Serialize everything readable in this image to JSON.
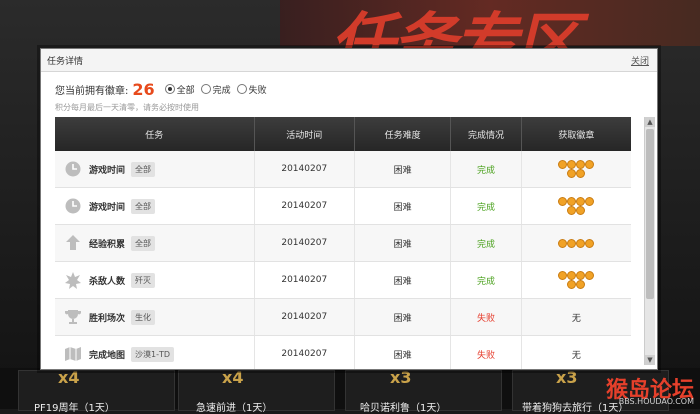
{
  "background": {
    "banner_text": "任务专区",
    "multipliers": [
      "x4",
      "x4",
      "x3",
      "x3"
    ],
    "strip_texts": [
      "PF19周年（1天）",
      "急速前进（1天）",
      "哈贝诺利鲁（1天）",
      "带着狗狗去旅行（1天）"
    ],
    "logo_text": "猴岛论坛",
    "logo_url": "BBS.HOUDAO.COM"
  },
  "modal": {
    "title": "任务详情",
    "close_label": "关闭",
    "summary_label": "您当前拥有徽章:",
    "badge_count": "26",
    "filters": [
      {
        "label": "全部",
        "selected": true
      },
      {
        "label": "完成",
        "selected": false
      },
      {
        "label": "失败",
        "selected": false
      }
    ],
    "note": "积分每月最后一天清零，请务必按时使用",
    "columns": [
      "任务",
      "活动时间",
      "任务难度",
      "完成情况",
      "获取徽章"
    ],
    "rows": [
      {
        "icon": "clock-icon",
        "name": "游戏时间",
        "tag": "全部",
        "date": "20140207",
        "difficulty": "困难",
        "status": "完成",
        "status_type": "done",
        "medals": 6,
        "medal_text": ""
      },
      {
        "icon": "clock-icon",
        "name": "游戏时间",
        "tag": "全部",
        "date": "20140207",
        "difficulty": "困难",
        "status": "完成",
        "status_type": "done",
        "medals": 6,
        "medal_text": ""
      },
      {
        "icon": "arrow-up-icon",
        "name": "经验积累",
        "tag": "全部",
        "date": "20140207",
        "difficulty": "困难",
        "status": "完成",
        "status_type": "done",
        "medals": 4,
        "medal_text": ""
      },
      {
        "icon": "starburst-icon",
        "name": "杀敌人数",
        "tag": "歼灭",
        "date": "20140207",
        "difficulty": "困难",
        "status": "完成",
        "status_type": "done",
        "medals": 6,
        "medal_text": ""
      },
      {
        "icon": "trophy-icon",
        "name": "胜利场次",
        "tag": "生化",
        "date": "20140207",
        "difficulty": "困难",
        "status": "失败",
        "status_type": "fail",
        "medals": 0,
        "medal_text": "无"
      },
      {
        "icon": "map-icon",
        "name": "完成地图",
        "tag": "沙漠1-TD",
        "date": "20140207",
        "difficulty": "困难",
        "status": "失败",
        "status_type": "fail",
        "medals": 0,
        "medal_text": "无"
      }
    ]
  },
  "colors": {
    "accent": "#e74a1c",
    "done": "#4aa11d",
    "fail": "#e53a2a",
    "medal": "#f1a226",
    "header_bg": "#2f2f2f"
  }
}
